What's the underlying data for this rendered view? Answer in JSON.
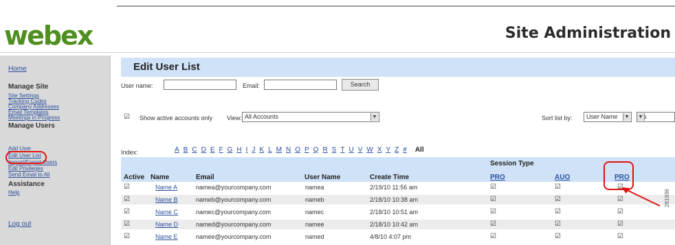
{
  "header": {
    "logo": "webex",
    "site_title": "Site Administration"
  },
  "sidebar": {
    "home": "Home",
    "manage_site": {
      "title": "Manage Site",
      "items": [
        "Site Settings",
        "Tracking Codes",
        "Company Addresses",
        "Email Templates",
        "Meetings in Progress"
      ]
    },
    "manage_users": {
      "title": "Manage Users",
      "items": [
        "Add User",
        "Edit User List",
        "Import/Export Users",
        "Edit Privileges",
        "Send Email to All"
      ]
    },
    "assistance": {
      "title": "Assistance",
      "items": [
        "Help"
      ]
    },
    "logout": "Log out"
  },
  "main": {
    "title": "Edit User List",
    "filter": {
      "username_label": "User name:",
      "username_value": "",
      "email_label": "Email:",
      "email_value": "",
      "search_button": "Search",
      "show_active_label": "Show active accounts only",
      "show_active_checked": true,
      "view_label": "View:",
      "view_value": "All Accounts",
      "sort_label": "Sort list by:",
      "sort_value": "User Name",
      "sort_order_value": "As"
    },
    "index": {
      "label": "Index:",
      "letters": [
        "A",
        "B",
        "C",
        "D",
        "E",
        "F",
        "G",
        "H",
        "I",
        "J",
        "K",
        "L",
        "M",
        "N",
        "O",
        "P",
        "Q",
        "R",
        "S",
        "T",
        "U",
        "V",
        "W",
        "X",
        "Y",
        "Z",
        "#"
      ],
      "all": "All"
    },
    "table": {
      "session_type": "Session Type",
      "columns": [
        "Active",
        "Name",
        "Email",
        "User Name",
        "Create Time",
        "PRO",
        "AUO",
        "PRO"
      ],
      "rows": [
        {
          "active": "☑",
          "name": "Name A",
          "email": "namea@yourcompany.com",
          "username": "namea",
          "created": "2/19/10 11:56 am",
          "pro": "☑",
          "auo": "☑",
          "pro2": "☑"
        },
        {
          "active": "☑",
          "name": "Name B",
          "email": "nameb@yourcompany.com",
          "username": "nameb",
          "created": "2/18/10 10:38 am",
          "pro": "☑",
          "auo": "☑",
          "pro2": "☑"
        },
        {
          "active": "☑",
          "name": "Name C",
          "email": "namec@yourcompany.com",
          "username": "namec",
          "created": "2/18/10 10:51 am",
          "pro": "☑",
          "auo": "☑",
          "pro2": "☑"
        },
        {
          "active": "☑",
          "name": "Name D",
          "email": "named@yourcompany.com",
          "username": "namee",
          "created": "2/18/10 10:42 am",
          "pro": "☑",
          "auo": "☑",
          "pro2": "☑"
        },
        {
          "active": "☑",
          "name": "Name E",
          "email": "namee@yourcompany.com",
          "username": "named",
          "created": "4/8/10 4:07 pm",
          "pro": "☑",
          "auo": "☑",
          "pro2": "☑"
        }
      ]
    }
  },
  "figure_number": "281936",
  "colors": {
    "accent_bar": "#cfe2f7",
    "highlight": "#e01010",
    "link": "#2b4f9e",
    "logo_green": "#4f8f1f"
  }
}
